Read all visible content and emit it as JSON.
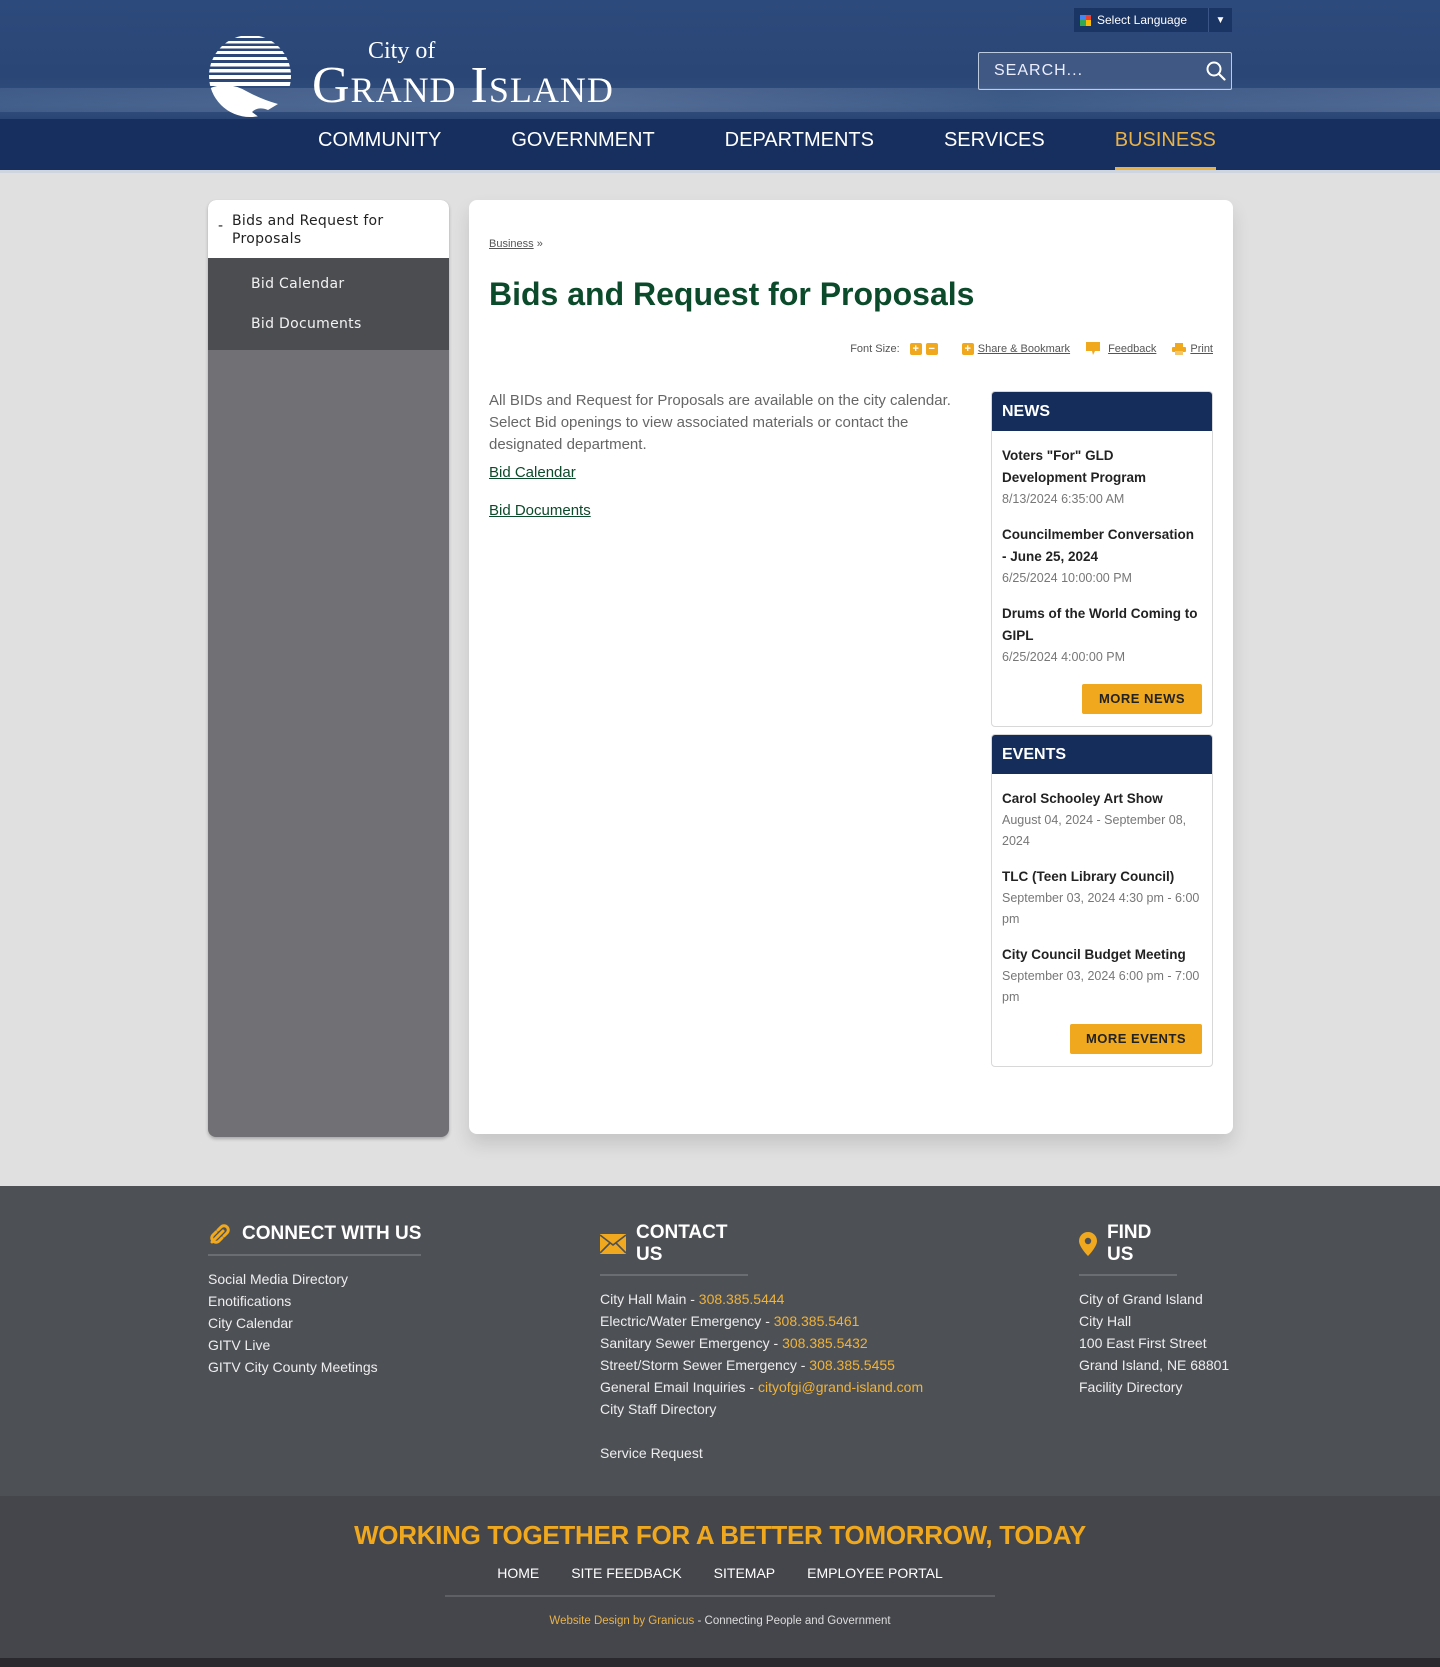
{
  "header": {
    "logo_small": "City of",
    "logo_name": "Grand Island",
    "language_label": "Select Language",
    "search_placeholder": "SEARCH..."
  },
  "nav": [
    {
      "label": "COMMUNITY",
      "active": false
    },
    {
      "label": "GOVERNMENT",
      "active": false
    },
    {
      "label": "DEPARTMENTS",
      "active": false
    },
    {
      "label": "SERVICES",
      "active": false
    },
    {
      "label": "BUSINESS",
      "active": true
    }
  ],
  "sidebar": {
    "current": "Bids and Request for Proposals",
    "items": [
      "Bid Calendar",
      "Bid Documents"
    ]
  },
  "breadcrumb": {
    "parent": "Business",
    "separator": "»"
  },
  "page": {
    "title": "Bids and Request for Proposals",
    "tools": {
      "font_size_label": "Font Size:",
      "share_label": "Share & Bookmark",
      "feedback_label": "Feedback",
      "print_label": "Print"
    },
    "body": "All BIDs and Request for Proposals are available on the city calendar. Select Bid openings to view associated materials or contact the designated department.",
    "links": [
      "Bid Calendar",
      "Bid Documents"
    ]
  },
  "news": {
    "heading": "NEWS",
    "items": [
      {
        "title": "Voters \"For\" GLD Development Program",
        "date": "8/13/2024 6:35:00 AM"
      },
      {
        "title": "Councilmember Conversation - June 25, 2024",
        "date": "6/25/2024 10:00:00 PM"
      },
      {
        "title": "Drums of the World Coming to GIPL",
        "date": "6/25/2024 4:00:00 PM"
      }
    ],
    "button": "MORE NEWS"
  },
  "events": {
    "heading": "EVENTS",
    "items": [
      {
        "title": "Carol Schooley Art Show",
        "date": "August 04, 2024 - September 08, 2024"
      },
      {
        "title": "TLC (Teen Library Council)",
        "date": "September 03, 2024 4:30 pm - 6:00 pm"
      },
      {
        "title": "City Council Budget Meeting",
        "date": "September 03, 2024 6:00 pm - 7:00 pm"
      }
    ],
    "button": "MORE EVENTS"
  },
  "footer": {
    "connect": {
      "heading": "CONNECT WITH US",
      "links": [
        "Social Media Directory",
        "Enotifications",
        "City Calendar",
        "GITV Live",
        "GITV City County Meetings"
      ]
    },
    "contact": {
      "heading": "CONTACT US",
      "lines": [
        {
          "label": "City Hall Main - ",
          "value": "308.385.5444"
        },
        {
          "label": "Electric/Water Emergency - ",
          "value": "308.385.5461"
        },
        {
          "label": "Sanitary Sewer Emergency - ",
          "value": "308.385.5432"
        },
        {
          "label": "Street/Storm Sewer Emergency - ",
          "value": "308.385.5455"
        },
        {
          "label": "General Email Inquiries - ",
          "value": "cityofgi@grand-island.com"
        }
      ],
      "staff_directory": "City Staff Directory",
      "service_request": "Service Request"
    },
    "find": {
      "heading": "FIND US",
      "lines": [
        "City of Grand Island",
        "City Hall",
        "100 East First Street",
        "Grand Island, NE 68801"
      ],
      "facility_link": "Facility Directory"
    },
    "slogan": "WORKING TOGETHER FOR A BETTER TOMORROW, TODAY",
    "bottom_links": [
      "HOME",
      "SITE FEEDBACK",
      "SITEMAP",
      "EMPLOYEE PORTAL"
    ],
    "credit_link": "Website Design by Granicus",
    "credit_text": " - Connecting People and Government"
  },
  "colors": {
    "brand_navy": "#152d5b",
    "accent_gold": "#f0a81e",
    "title_green": "#0b4a2a",
    "footer_gray": "#4d5055"
  }
}
